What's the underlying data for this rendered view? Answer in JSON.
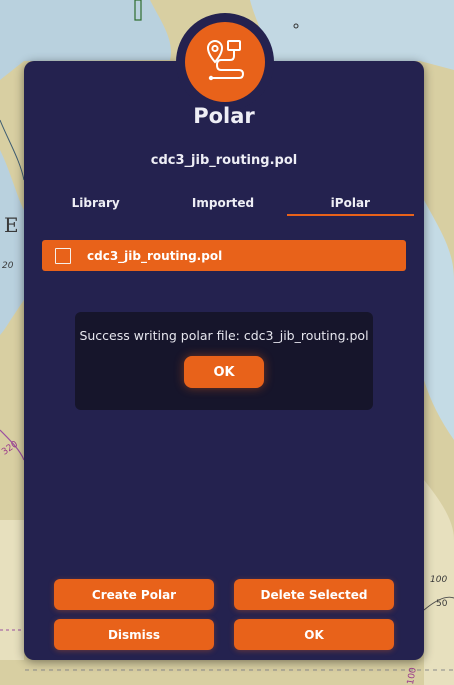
{
  "dialog": {
    "title": "Polar",
    "subtitle": "cdc3_jib_routing.pol",
    "icon": "route-icon"
  },
  "tabs": [
    {
      "label": "Library",
      "active": false
    },
    {
      "label": "Imported",
      "active": false
    },
    {
      "label": "iPolar",
      "active": true
    }
  ],
  "files": [
    {
      "name": "cdc3_jib_routing.pol",
      "checked": false
    }
  ],
  "message": {
    "text": "Success writing polar file: cdc3_jib_routing.pol",
    "ok_label": "OK"
  },
  "actions": {
    "create_label": "Create Polar",
    "delete_label": "Delete Selected",
    "dismiss_label": "Dismiss",
    "ok_label": "OK"
  },
  "map": {
    "labels": [
      "E",
      "20",
      "320",
      "100",
      "50",
      "100"
    ]
  },
  "colors": {
    "accent": "#e8621a",
    "panel": "#24224f",
    "message_bg": "#16152b",
    "map_land": "#d8cfa2",
    "map_water": "#b9d1de"
  }
}
